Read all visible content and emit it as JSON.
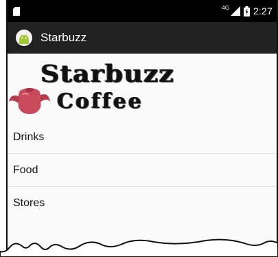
{
  "status_bar": {
    "network_type": "4G",
    "time": "2:27",
    "icons": [
      "sim-icon",
      "signal-icon",
      "battery-icon"
    ]
  },
  "app_bar": {
    "title": "Starbuzz",
    "icon": "android-icon"
  },
  "logo": {
    "line1": "Starbuzz",
    "line2": "Coffee",
    "image": "teapot-icon"
  },
  "menu": {
    "items": [
      {
        "label": "Drinks"
      },
      {
        "label": "Food"
      },
      {
        "label": "Stores"
      }
    ]
  },
  "colors": {
    "status_bar": "#000000",
    "app_bar": "#212121",
    "android_green": "#a4c639",
    "teapot": "#c84b5c",
    "background": "#fafafa"
  }
}
